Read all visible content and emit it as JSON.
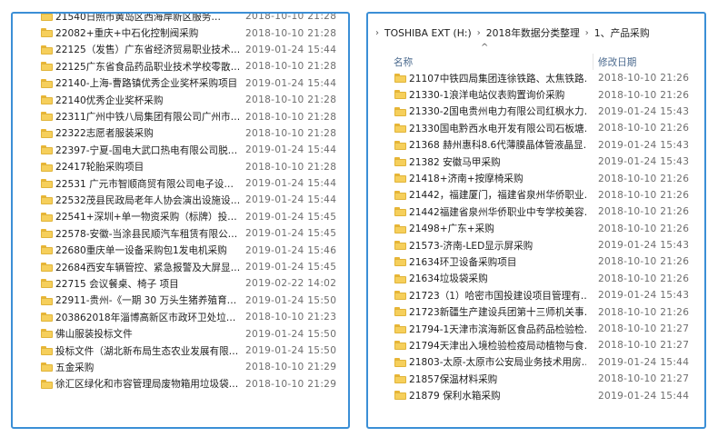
{
  "left_pane": {
    "rows": [
      {
        "name": "21540日照市黄岛区西海岸新区服务…",
        "date": "2018-10-10 21:28"
      },
      {
        "name": "22082+重庆+中石化控制阀采购",
        "date": "2018-10-10 21:28"
      },
      {
        "name": "22125（发售）广东省经济贸易职业技术…",
        "date": "2019-01-24 15:44"
      },
      {
        "name": "22125广东省食品药品职业技术学校零散…",
        "date": "2018-10-10 21:28"
      },
      {
        "name": "22140-上海-曹路镇优秀企业奖杯采购项目",
        "date": "2019-01-24 15:44"
      },
      {
        "name": "22140优秀企业奖杯采购",
        "date": "2018-10-10 21:28"
      },
      {
        "name": "22311广州中铁八局集团有限公司广州市…",
        "date": "2018-10-10 21:28"
      },
      {
        "name": "22322志愿者服装采购",
        "date": "2018-10-10 21:28"
      },
      {
        "name": "22397-宁夏-国电大武口热电有限公司脱…",
        "date": "2019-01-24 15:44"
      },
      {
        "name": "22417轮胎采购项目",
        "date": "2018-10-10 21:28"
      },
      {
        "name": "22531 广元市智顺商贸有限公司电子设…",
        "date": "2019-01-24 15:44"
      },
      {
        "name": "22532茂县民政局老年人协会演出设施设…",
        "date": "2019-01-24 15:44"
      },
      {
        "name": "22541+深圳+单一物资采购（标牌）投…",
        "date": "2019-01-24 15:45"
      },
      {
        "name": "22578-安徽-当涂县民顺汽车租赁有限公…",
        "date": "2019-01-24 15:45"
      },
      {
        "name": "22680重庆单一设备采购包1发电机采购",
        "date": "2019-01-24 15:46"
      },
      {
        "name": "22684西安车辆管控、紧急报警及大屏显…",
        "date": "2019-01-24 15:45"
      },
      {
        "name": "22715 会议餐桌、椅子 项目",
        "date": "2019-02-22 14:02"
      },
      {
        "name": "22911-贵州-《一期 30 万头生猪养殖育…",
        "date": "2019-01-24 15:50"
      },
      {
        "name": "203862018年淄博高新区市政环卫处垃…",
        "date": "2018-10-10 21:23"
      },
      {
        "name": "佛山服装投标文件",
        "date": "2019-01-24 15:50"
      },
      {
        "name": "投标文件（湖北新布局生态农业发展有限…",
        "date": "2019-01-24 15:50"
      },
      {
        "name": "五金采购",
        "date": "2018-10-10 21:29"
      },
      {
        "name": "徐汇区绿化和市容管理局废物箱用垃圾袋…",
        "date": "2018-10-10 21:29"
      }
    ]
  },
  "right_pane": {
    "breadcrumb": [
      "TOSHIBA EXT (H:)",
      "2018年数据分类整理",
      "1、产品采购"
    ],
    "header": {
      "name": "名称",
      "date": "修改日期"
    },
    "sort_indicator": "^",
    "rows": [
      {
        "name": "21107中铁四局集团连徐铁路、太焦铁路…",
        "date": "2018-10-10 21:26"
      },
      {
        "name": "21330-1浪洋电站仪表购置询价采购",
        "date": "2018-10-10 21:26"
      },
      {
        "name": "21330-2国电贵州电力有限公司红枫水力…",
        "date": "2019-01-24 15:43"
      },
      {
        "name": "21330国电黔西水电开发有限公司石板塘…",
        "date": "2018-10-10 21:26"
      },
      {
        "name": "21368 赫州惠科8.6代薄膜晶体管液晶显…",
        "date": "2019-01-24 15:43"
      },
      {
        "name": "21382 安徽马甲采购",
        "date": "2019-01-24 15:43"
      },
      {
        "name": "21418+济南+按摩椅采购",
        "date": "2018-10-10 21:26"
      },
      {
        "name": "21442，福建厦门，福建省泉州华侨职业…",
        "date": "2018-10-10 21:26"
      },
      {
        "name": "21442福建省泉州华侨职业中专学校美容…",
        "date": "2018-10-10 21:26"
      },
      {
        "name": "21498+广东+采购",
        "date": "2018-10-10 21:26"
      },
      {
        "name": "21573-济南-LED显示屏采购",
        "date": "2019-01-24 15:43"
      },
      {
        "name": "21634环卫设备采购项目",
        "date": "2018-10-10 21:26"
      },
      {
        "name": "21634垃圾袋采购",
        "date": "2018-10-10 21:26"
      },
      {
        "name": "21723（1）哈密市国投建设项目管理有…",
        "date": "2019-01-24 15:43"
      },
      {
        "name": "21723新疆生产建设兵团第十三师机关事…",
        "date": "2018-10-10 21:26"
      },
      {
        "name": "21794-1天津市滨海新区食品药品检验检…",
        "date": "2018-10-10 21:27"
      },
      {
        "name": "21794天津出入境检验检疫局动植物与食…",
        "date": "2018-10-10 21:27"
      },
      {
        "name": "21803-太原-太原市公安局业务技术用房…",
        "date": "2019-01-24 15:44"
      },
      {
        "name": "21857保温材料采购",
        "date": "2018-10-10 21:27"
      },
      {
        "name": "21879 保利水箱采购",
        "date": "2019-01-24 15:44"
      }
    ]
  }
}
